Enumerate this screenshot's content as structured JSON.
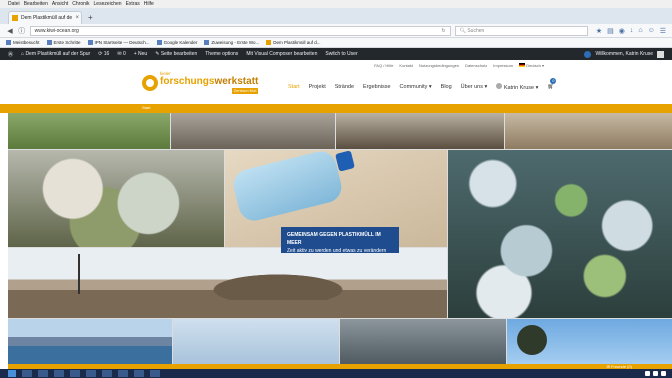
{
  "browser": {
    "menu": [
      "Datei",
      "Bearbeiten",
      "Ansicht",
      "Chronik",
      "Lesezeichen",
      "Extras",
      "Hilfe"
    ],
    "tab_title": "Dem Plastikmüll auf der Sp...",
    "new_tab": "+",
    "url": "www.kiwi-ocean.org",
    "search_placeholder": "Suchen",
    "bookmarks": [
      "Meistbesucht",
      "Erste Schritte",
      "IPN Startseite — Deutsch...",
      "Google Kalender",
      "Zuweisung - Erste Wo...",
      "Dem Plastikmüll auf d..."
    ]
  },
  "adminbar": {
    "site": "Dem Plastikmüll auf der Spur",
    "updates": "16",
    "comments": "0",
    "new": "Neu",
    "edit": "Seite bearbeiten",
    "theme": "Theme options",
    "composer": "Mit Visual Composer bearbeiten",
    "switch": "Switch to User",
    "greeting": "Willkommen, Katrin Kruse"
  },
  "logo": {
    "small": "kieler",
    "main_a": "forschungs",
    "main_b": "werkstatt",
    "tag": "Zentrum Kiel"
  },
  "toplinks": [
    "FAQ / Hilfe",
    "Kontakt",
    "Nutzungsbedingungen",
    "Datenschutz",
    "Impressum",
    "Deutsch"
  ],
  "nav": [
    "Start",
    "Projekt",
    "Strände",
    "Ergebnisse",
    "Community",
    "Blog",
    "Über uns",
    "Katrin Kruse"
  ],
  "cart_count": "0",
  "breadcrumb": "Start",
  "hero": {
    "line1": "GEMEINSAM GEGEN PLASTIKMÜLL IM MEER",
    "line2": "Zeit aktiv zu werden und etwas zu verändern"
  },
  "cookie": "Freunde (0)",
  "colors": {
    "accent": "#e8a200",
    "hero_box": "#1f4c8e",
    "adminbar": "#23282d"
  }
}
